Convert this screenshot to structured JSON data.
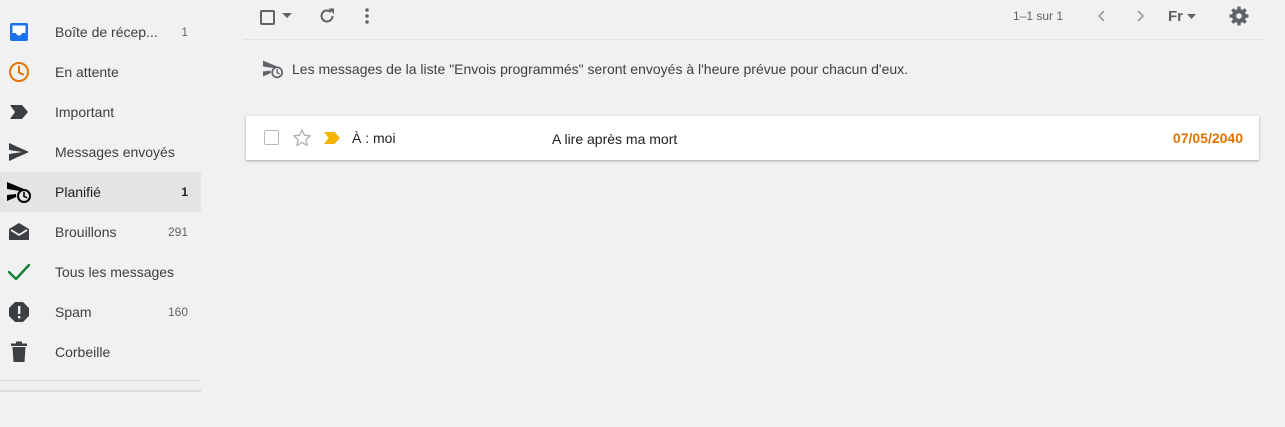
{
  "sidebar": {
    "items": [
      {
        "label": "Boîte de récep...",
        "count": "1"
      },
      {
        "label": "En attente",
        "count": ""
      },
      {
        "label": "Important",
        "count": ""
      },
      {
        "label": "Messages envoyés",
        "count": ""
      },
      {
        "label": "Planifié",
        "count": "1"
      },
      {
        "label": "Brouillons",
        "count": "291"
      },
      {
        "label": "Tous les messages",
        "count": ""
      },
      {
        "label": "Spam",
        "count": "160"
      },
      {
        "label": "Corbeille",
        "count": ""
      }
    ]
  },
  "toolbar": {
    "page_info": "1–1 sur 1",
    "language": "Fr"
  },
  "banner": {
    "text": "Les messages de la liste \"Envois programmés\" seront envoyés à l'heure prévue pour chacun d'eux."
  },
  "messages": [
    {
      "sender": "À : moi",
      "subject": "A lire après ma mort",
      "date": "07/05/2040"
    }
  ],
  "colors": {
    "date_accent": "#e37400",
    "important_marker": "#f4b400",
    "all_mail_check": "#188038",
    "snoozed": "#e37400",
    "inbox": "#1a73e8"
  }
}
